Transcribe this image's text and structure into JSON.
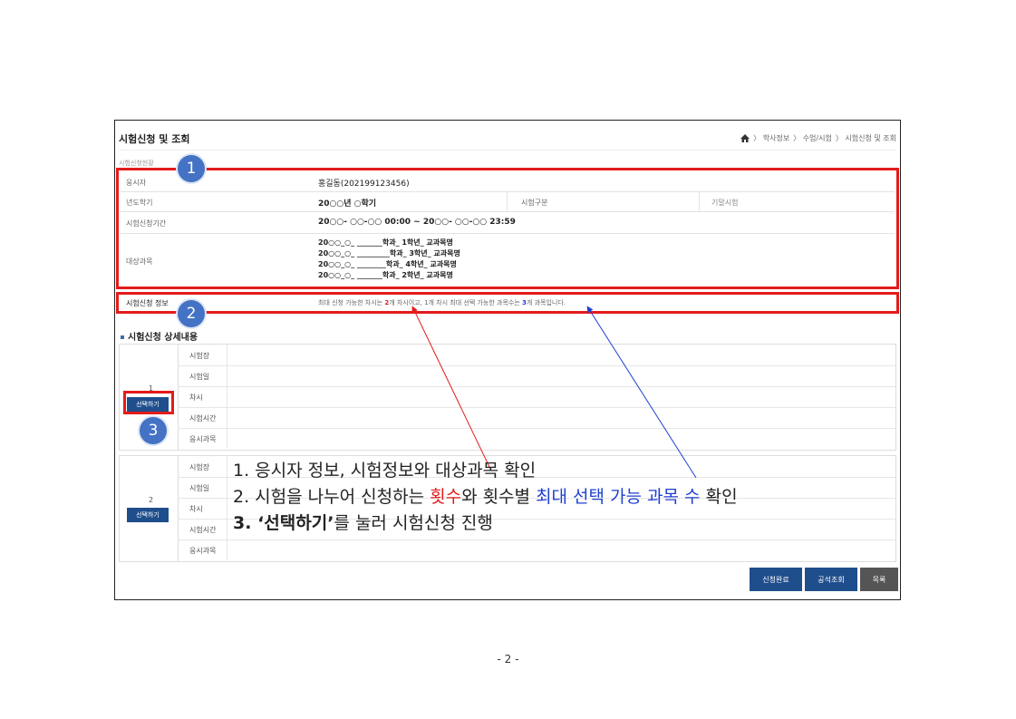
{
  "header": {
    "title": "시험신청 및 조회",
    "breadcrumb": [
      "〉 학사정보",
      "〉 수업/시험",
      "〉 시험신청 및 조회"
    ]
  },
  "section_small": "시험신청현황",
  "info": {
    "applicant_label": "응시자",
    "applicant_value": "홍길동(202199123456)",
    "term_label": "년도학기",
    "term_value": "20○○년 ○학기",
    "exam_type_label": "시험구분",
    "exam_type_value": "기말시험",
    "period_label": "시험신청기간",
    "period_value": "20○○- ○○-○○ 00:00 ~ 20○○- ○○-○○ 23:59",
    "subjects_label": "대상과목",
    "subjects": [
      "20○○_○_ _______학과_ 1학년_ 교과목명",
      "20○○_○_ _________학과_ 3학년_ 교과목명",
      "20○○_○_ ________학과_ 4학년_ 교과목명",
      "20○○_○_ _______학과_ 2학년_ 교과목명"
    ],
    "exam_info_label": "시험신청 정보",
    "exam_info_pre": "최대 신청 가능한 차시는 ",
    "exam_info_n1": "2",
    "exam_info_mid": "개 차시이고, 1개 차시 최대 선택 가능한 과목수는 ",
    "exam_info_n2": "3",
    "exam_info_post": "개 과목입니다."
  },
  "detail": {
    "title": "시험신청 상세내용",
    "row_labels": [
      "시험장",
      "시험일",
      "차시",
      "시험시간",
      "응시과목"
    ],
    "groups": [
      {
        "number": "1",
        "button": "선택하기"
      },
      {
        "number": "2",
        "button": "선택하기"
      }
    ]
  },
  "markers": [
    "1",
    "2",
    "3"
  ],
  "annotation": {
    "line1": "1.  응시자 정보, 시험정보와 대상과목 확인",
    "line2_a": "2.  시험을 나누어 신청하는 ",
    "line2_red": "횟수",
    "line2_b": "와 횟수별 ",
    "line2_blue": "최대 선택 가능 과목 수",
    "line2_c": " 확인",
    "line3_num": "3.  ",
    "line3_bold": "‘선택하기’",
    "line3_rest": "를 눌러 시험신청 진행"
  },
  "buttons": {
    "complete": "신청완료",
    "seat": "공석조회",
    "list": "목록"
  },
  "colors": {
    "accent_red": "#e31b1b",
    "accent_blue": "#1f3fd0",
    "marker": "#4472c4",
    "button_blue": "#1f4e8c",
    "button_gray": "#555555"
  },
  "page_number": "- 2 -"
}
